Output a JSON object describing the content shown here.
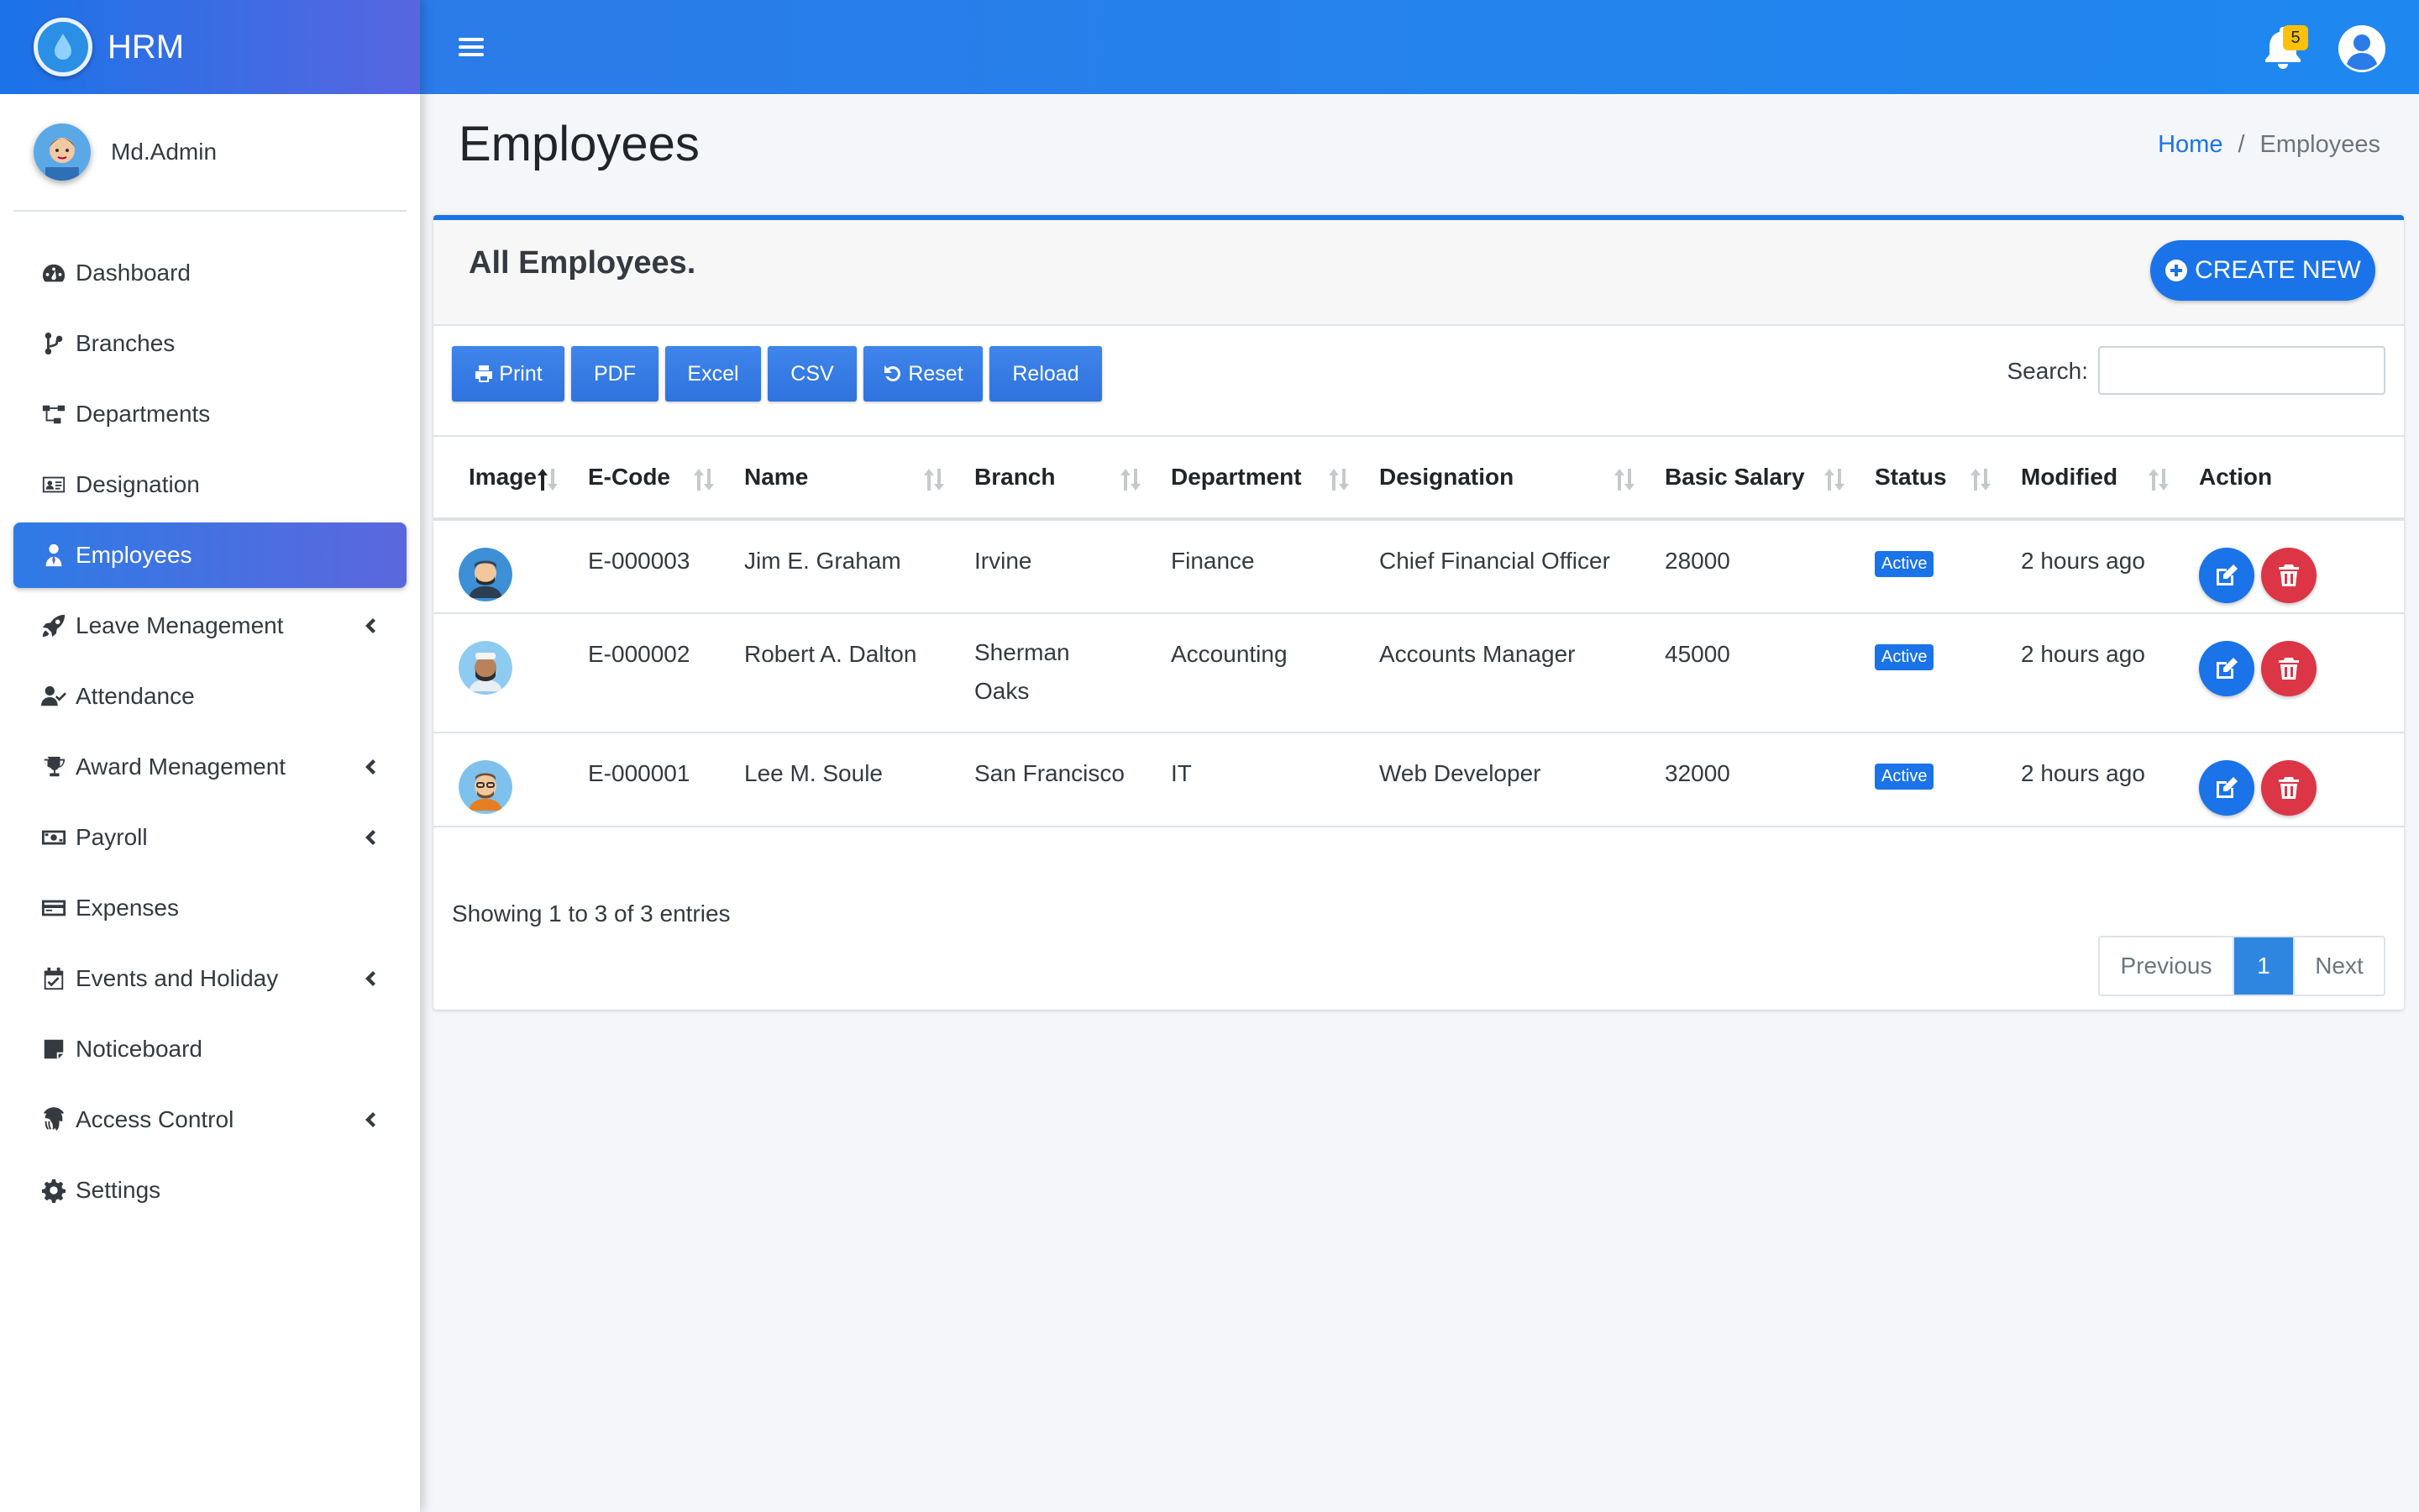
{
  "brand": {
    "name": "HRM",
    "logo_icon": "water-drop-logo-icon"
  },
  "user": {
    "name": "Md.Admin"
  },
  "sidebar": {
    "items": [
      {
        "label": "Dashboard",
        "icon": "tachometer-icon",
        "has_submenu": false
      },
      {
        "label": "Branches",
        "icon": "code-branch-icon",
        "has_submenu": false
      },
      {
        "label": "Departments",
        "icon": "sitemap-icon",
        "has_submenu": false
      },
      {
        "label": "Designation",
        "icon": "id-card-icon",
        "has_submenu": false
      },
      {
        "label": "Employees",
        "icon": "user-tie-icon",
        "has_submenu": false,
        "active": true
      },
      {
        "label": "Leave Menagement",
        "icon": "rocket-icon",
        "has_submenu": true
      },
      {
        "label": "Attendance",
        "icon": "user-check-icon",
        "has_submenu": false
      },
      {
        "label": "Award Menagement",
        "icon": "trophy-icon",
        "has_submenu": true
      },
      {
        "label": "Payroll",
        "icon": "money-bill-icon",
        "has_submenu": true
      },
      {
        "label": "Expenses",
        "icon": "credit-card-icon",
        "has_submenu": false
      },
      {
        "label": "Events and Holiday",
        "icon": "calendar-check-icon",
        "has_submenu": true
      },
      {
        "label": "Noticeboard",
        "icon": "sticky-note-icon",
        "has_submenu": false
      },
      {
        "label": "Access Control",
        "icon": "fingerprint-icon",
        "has_submenu": true
      },
      {
        "label": "Settings",
        "icon": "cog-icon",
        "has_submenu": false
      }
    ]
  },
  "topbar": {
    "notification_count": "5"
  },
  "page": {
    "title": "Employees"
  },
  "breadcrumb": {
    "home": "Home",
    "separator": "/",
    "current": "Employees"
  },
  "card": {
    "title": "All Employees.",
    "create_label": "CREATE NEW"
  },
  "toolbar": {
    "print": "Print",
    "pdf": "PDF",
    "excel": "Excel",
    "csv": "CSV",
    "reset": "Reset",
    "reload": "Reload"
  },
  "search": {
    "label": "Search:",
    "value": "",
    "placeholder": ""
  },
  "table": {
    "headers": [
      "Image",
      "E-Code",
      "Name",
      "Branch",
      "Department",
      "Designation",
      "Basic Salary",
      "Status",
      "Modified",
      "Action"
    ],
    "rows": [
      {
        "code": "E-000003",
        "name": "Jim E. Graham",
        "branch": "Irvine",
        "department": "Finance",
        "designation": "Chief Financial Officer",
        "salary": "28000",
        "status": "Active",
        "modified": "2 hours ago"
      },
      {
        "code": "E-000002",
        "name": "Robert A. Dalton",
        "branch": "Sherman Oaks",
        "department": "Accounting",
        "designation": "Accounts Manager",
        "salary": "45000",
        "status": "Active",
        "modified": "2 hours ago"
      },
      {
        "code": "E-000001",
        "name": "Lee M. Soule",
        "branch": "San Francisco",
        "department": "IT",
        "designation": "Web Developer",
        "salary": "32000",
        "status": "Active",
        "modified": "2 hours ago"
      }
    ]
  },
  "footer": {
    "info": "Showing 1 to 3 of 3 entries",
    "previous": "Previous",
    "current_page": "1",
    "next": "Next"
  },
  "colors": {
    "primary": "#1a73e8",
    "danger": "#dc3545",
    "badge": "#ffc107"
  }
}
